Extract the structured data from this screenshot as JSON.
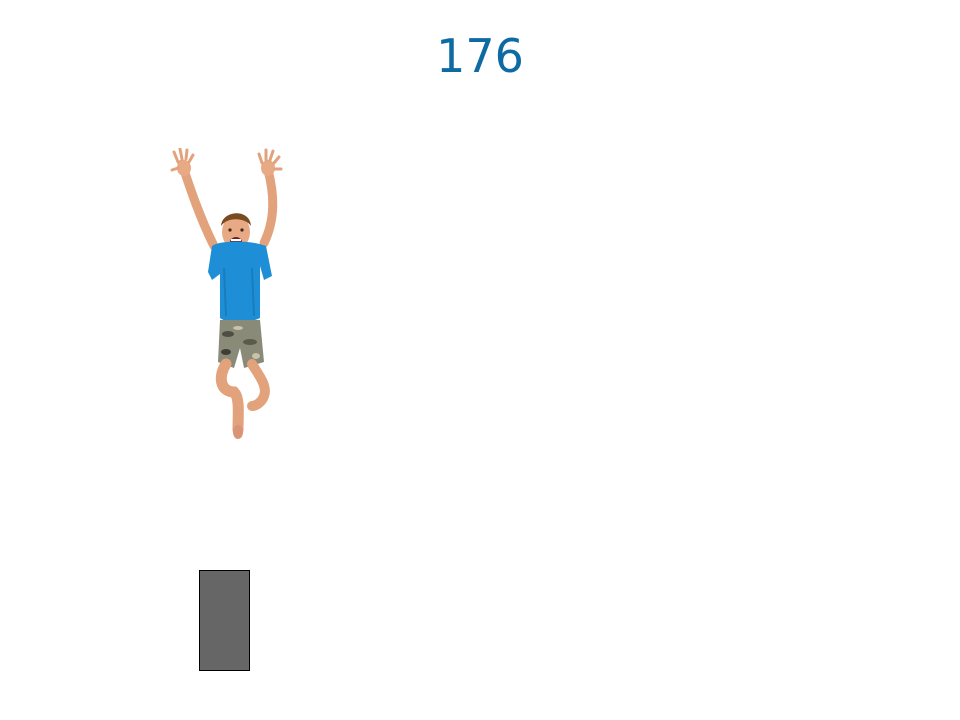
{
  "score": "176",
  "player": {
    "description_icon": "jumping-boy-sprite",
    "shirt_color": "#1e8fd6",
    "skin_color": "#e2a27c",
    "hair_color": "#7a4a22",
    "shorts_color": "#8a8a78"
  },
  "obstacle": {
    "color": "#666666"
  }
}
